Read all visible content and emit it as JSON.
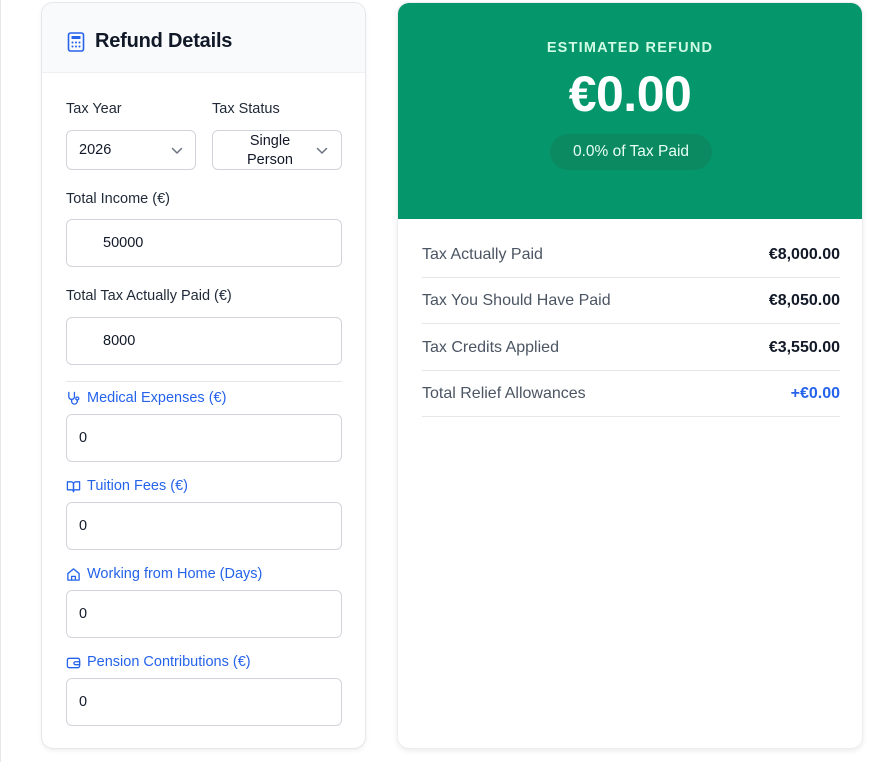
{
  "form": {
    "title": "Refund Details",
    "tax_year": {
      "label": "Tax Year",
      "value": "2026"
    },
    "tax_status": {
      "label": "Tax Status",
      "value_line1": "Single",
      "value_line2": "Person"
    },
    "total_income": {
      "label": "Total Income (€)",
      "value": "50000"
    },
    "tax_paid": {
      "label": "Total Tax Actually Paid (€)",
      "value": "8000"
    },
    "medical": {
      "label": "Medical Expenses (€)",
      "value": "0",
      "icon": "stethoscope-icon"
    },
    "tuition": {
      "label": "Tuition Fees (€)",
      "value": "0",
      "icon": "book-open-icon"
    },
    "wfh": {
      "label": "Working from Home (Days)",
      "value": "0",
      "icon": "home-icon"
    },
    "pension": {
      "label": "Pension Contributions (€)",
      "value": "0",
      "icon": "wallet-icon"
    }
  },
  "result": {
    "heading": "ESTIMATED REFUND",
    "amount": "€0.00",
    "percent": "0.0% of Tax Paid",
    "rows": [
      {
        "label": "Tax Actually Paid",
        "value": "€8,000.00"
      },
      {
        "label": "Tax You Should Have Paid",
        "value": "€8,050.00"
      },
      {
        "label": "Tax Credits Applied",
        "value": "€3,550.00"
      },
      {
        "label": "Total Relief Allowances",
        "value": "+€0.00"
      }
    ]
  },
  "colors": {
    "accent_green": "#05966b",
    "link_blue": "#2563eb"
  }
}
